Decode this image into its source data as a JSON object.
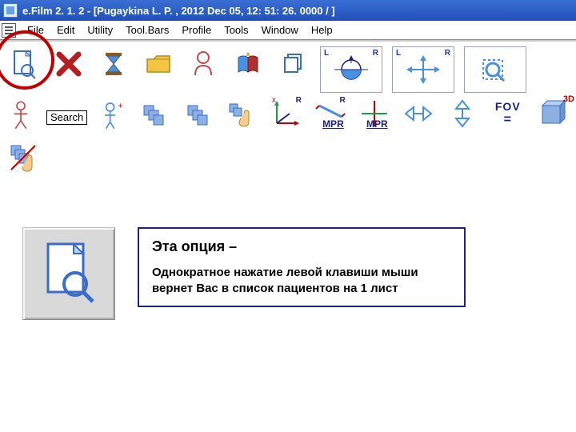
{
  "titlebar": {
    "text": "e.Film 2. 1. 2 - [Pugaykina L. P. , 2012 Dec 05, 12: 51: 26. 0000  /  ]"
  },
  "menu": {
    "items": [
      "File",
      "Edit",
      "Utility",
      "Tool.Bars",
      "Profile",
      "Tools",
      "Window",
      "Help"
    ]
  },
  "row2_labels": {
    "l": "L",
    "r": "R"
  },
  "row2_search_label": "Search",
  "row2_mpr": "MPR",
  "row3_labels": {
    "l": "L",
    "r": "R"
  },
  "fov": {
    "label": "FOV",
    "eq": "="
  },
  "threeD": "3D",
  "callout": {
    "heading": "Эта опция –",
    "body": "Однократное нажатие левой клавиши мыши вернет Вас в список пациентов на 1 лист"
  }
}
